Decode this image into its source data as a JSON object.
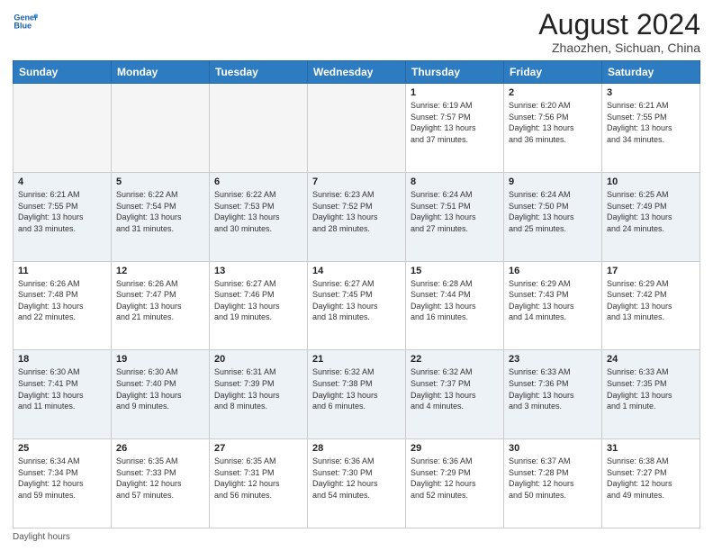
{
  "header": {
    "logo_line1": "General",
    "logo_line2": "Blue",
    "month_year": "August 2024",
    "location": "Zhaozhen, Sichuan, China"
  },
  "days_of_week": [
    "Sunday",
    "Monday",
    "Tuesday",
    "Wednesday",
    "Thursday",
    "Friday",
    "Saturday"
  ],
  "weeks": [
    [
      {
        "day": "",
        "info": ""
      },
      {
        "day": "",
        "info": ""
      },
      {
        "day": "",
        "info": ""
      },
      {
        "day": "",
        "info": ""
      },
      {
        "day": "1",
        "info": "Sunrise: 6:19 AM\nSunset: 7:57 PM\nDaylight: 13 hours\nand 37 minutes."
      },
      {
        "day": "2",
        "info": "Sunrise: 6:20 AM\nSunset: 7:56 PM\nDaylight: 13 hours\nand 36 minutes."
      },
      {
        "day": "3",
        "info": "Sunrise: 6:21 AM\nSunset: 7:55 PM\nDaylight: 13 hours\nand 34 minutes."
      }
    ],
    [
      {
        "day": "4",
        "info": "Sunrise: 6:21 AM\nSunset: 7:55 PM\nDaylight: 13 hours\nand 33 minutes."
      },
      {
        "day": "5",
        "info": "Sunrise: 6:22 AM\nSunset: 7:54 PM\nDaylight: 13 hours\nand 31 minutes."
      },
      {
        "day": "6",
        "info": "Sunrise: 6:22 AM\nSunset: 7:53 PM\nDaylight: 13 hours\nand 30 minutes."
      },
      {
        "day": "7",
        "info": "Sunrise: 6:23 AM\nSunset: 7:52 PM\nDaylight: 13 hours\nand 28 minutes."
      },
      {
        "day": "8",
        "info": "Sunrise: 6:24 AM\nSunset: 7:51 PM\nDaylight: 13 hours\nand 27 minutes."
      },
      {
        "day": "9",
        "info": "Sunrise: 6:24 AM\nSunset: 7:50 PM\nDaylight: 13 hours\nand 25 minutes."
      },
      {
        "day": "10",
        "info": "Sunrise: 6:25 AM\nSunset: 7:49 PM\nDaylight: 13 hours\nand 24 minutes."
      }
    ],
    [
      {
        "day": "11",
        "info": "Sunrise: 6:26 AM\nSunset: 7:48 PM\nDaylight: 13 hours\nand 22 minutes."
      },
      {
        "day": "12",
        "info": "Sunrise: 6:26 AM\nSunset: 7:47 PM\nDaylight: 13 hours\nand 21 minutes."
      },
      {
        "day": "13",
        "info": "Sunrise: 6:27 AM\nSunset: 7:46 PM\nDaylight: 13 hours\nand 19 minutes."
      },
      {
        "day": "14",
        "info": "Sunrise: 6:27 AM\nSunset: 7:45 PM\nDaylight: 13 hours\nand 18 minutes."
      },
      {
        "day": "15",
        "info": "Sunrise: 6:28 AM\nSunset: 7:44 PM\nDaylight: 13 hours\nand 16 minutes."
      },
      {
        "day": "16",
        "info": "Sunrise: 6:29 AM\nSunset: 7:43 PM\nDaylight: 13 hours\nand 14 minutes."
      },
      {
        "day": "17",
        "info": "Sunrise: 6:29 AM\nSunset: 7:42 PM\nDaylight: 13 hours\nand 13 minutes."
      }
    ],
    [
      {
        "day": "18",
        "info": "Sunrise: 6:30 AM\nSunset: 7:41 PM\nDaylight: 13 hours\nand 11 minutes."
      },
      {
        "day": "19",
        "info": "Sunrise: 6:30 AM\nSunset: 7:40 PM\nDaylight: 13 hours\nand 9 minutes."
      },
      {
        "day": "20",
        "info": "Sunrise: 6:31 AM\nSunset: 7:39 PM\nDaylight: 13 hours\nand 8 minutes."
      },
      {
        "day": "21",
        "info": "Sunrise: 6:32 AM\nSunset: 7:38 PM\nDaylight: 13 hours\nand 6 minutes."
      },
      {
        "day": "22",
        "info": "Sunrise: 6:32 AM\nSunset: 7:37 PM\nDaylight: 13 hours\nand 4 minutes."
      },
      {
        "day": "23",
        "info": "Sunrise: 6:33 AM\nSunset: 7:36 PM\nDaylight: 13 hours\nand 3 minutes."
      },
      {
        "day": "24",
        "info": "Sunrise: 6:33 AM\nSunset: 7:35 PM\nDaylight: 13 hours\nand 1 minute."
      }
    ],
    [
      {
        "day": "25",
        "info": "Sunrise: 6:34 AM\nSunset: 7:34 PM\nDaylight: 12 hours\nand 59 minutes."
      },
      {
        "day": "26",
        "info": "Sunrise: 6:35 AM\nSunset: 7:33 PM\nDaylight: 12 hours\nand 57 minutes."
      },
      {
        "day": "27",
        "info": "Sunrise: 6:35 AM\nSunset: 7:31 PM\nDaylight: 12 hours\nand 56 minutes."
      },
      {
        "day": "28",
        "info": "Sunrise: 6:36 AM\nSunset: 7:30 PM\nDaylight: 12 hours\nand 54 minutes."
      },
      {
        "day": "29",
        "info": "Sunrise: 6:36 AM\nSunset: 7:29 PM\nDaylight: 12 hours\nand 52 minutes."
      },
      {
        "day": "30",
        "info": "Sunrise: 6:37 AM\nSunset: 7:28 PM\nDaylight: 12 hours\nand 50 minutes."
      },
      {
        "day": "31",
        "info": "Sunrise: 6:38 AM\nSunset: 7:27 PM\nDaylight: 12 hours\nand 49 minutes."
      }
    ]
  ],
  "footer": {
    "daylight_label": "Daylight hours"
  }
}
